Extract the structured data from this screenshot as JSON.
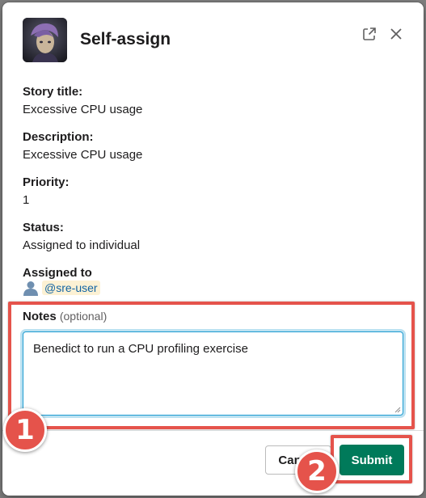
{
  "dialog": {
    "title": "Self-assign"
  },
  "fields": {
    "story_title_label": "Story title:",
    "story_title_value": "Excessive CPU usage",
    "description_label": "Description:",
    "description_value": "Excessive CPU usage",
    "priority_label": "Priority:",
    "priority_value": "1",
    "status_label": "Status:",
    "status_value": "Assigned to individual",
    "assigned_label": "Assigned to",
    "assigned_user": "@sre-user"
  },
  "notes": {
    "label": "Notes",
    "optional": "(optional)",
    "value": "Benedict to run a CPU profiling exercise"
  },
  "footer": {
    "cancel_label": "Cancel",
    "submit_label": "Submit"
  },
  "annotations": {
    "badge_1": "1",
    "badge_2": "2"
  },
  "colors": {
    "accent_submit": "#007a5a",
    "annotation_red": "#e5534b",
    "focus_blue": "#1d9bd1",
    "mention_bg": "#fcf1d4",
    "mention_text": "#1264a3"
  },
  "icons": {
    "external": "external-link-icon",
    "close": "close-icon",
    "user": "user-icon"
  }
}
